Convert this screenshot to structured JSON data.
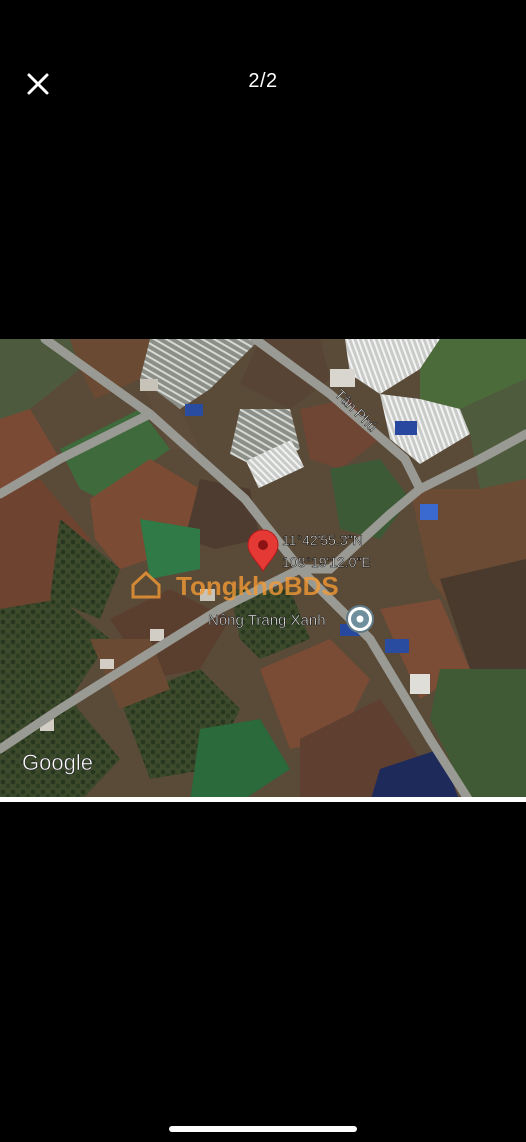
{
  "header": {
    "close_icon": "close-icon",
    "page_counter": "2/2"
  },
  "photo": {
    "coordinates": {
      "latitude": "11°42'55.3\"N",
      "longitude": "108°19'12.0\"E"
    },
    "road_label": "Tân Phú",
    "place_label": "Nông Trang Xanh",
    "watermark": "TongkhoBDS",
    "map_brand": "Google",
    "pin_color": "#e53935",
    "place_icon": "location-pin-icon"
  }
}
